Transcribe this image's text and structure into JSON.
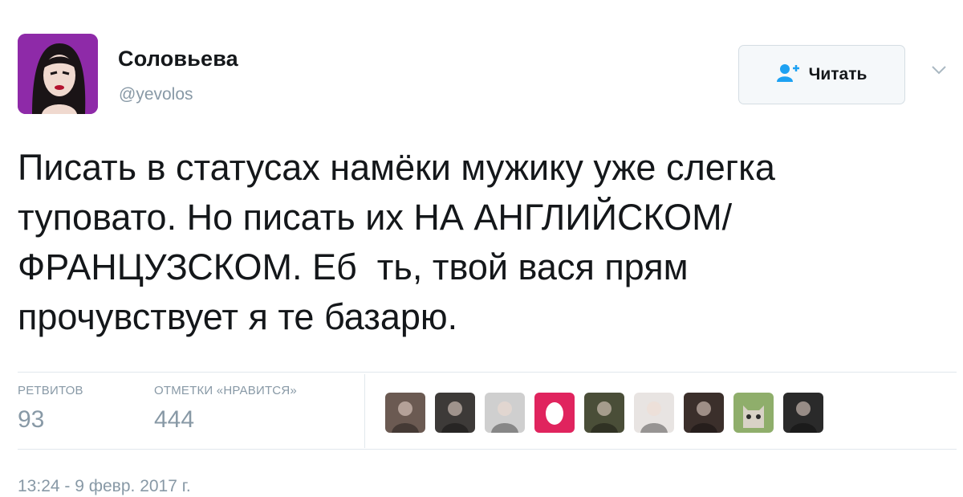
{
  "user": {
    "display_name": "Соловьева",
    "handle": "@yevolos"
  },
  "follow_button": {
    "label": "Читать",
    "icon": "add-user-icon"
  },
  "menu": {
    "icon": "chevron-down-icon"
  },
  "tweet": {
    "lines": [
      "Писать в статусах намёки мужику уже слегка",
      "туповато. Но писать их НА АНГЛИЙСКОМ/",
      "ФРАНЦУЗСКОМ. Еб  ть, твой вася прям",
      "прочувствует я те базарю."
    ]
  },
  "stats": {
    "retweets_label": "РЕТВИТОВ",
    "retweets_count": "93",
    "likes_label": "ОТМЕТКИ «НРАВИТСЯ»",
    "likes_count": "444"
  },
  "likers": [
    {
      "icon": "user-avatar",
      "bg": "#6b5a52"
    },
    {
      "icon": "user-avatar",
      "bg": "#3d3a38"
    },
    {
      "icon": "user-avatar",
      "bg": "#cfcfcf"
    },
    {
      "icon": "egg-avatar",
      "bg": "#e0245e"
    },
    {
      "icon": "user-avatar",
      "bg": "#4a4e38"
    },
    {
      "icon": "user-avatar",
      "bg": "#e8e4e2"
    },
    {
      "icon": "user-avatar",
      "bg": "#3b2f2b"
    },
    {
      "icon": "cat-avatar",
      "bg": "#8fae6b"
    },
    {
      "icon": "user-avatar",
      "bg": "#2a2a2a"
    }
  ],
  "timestamp": "13:24 - 9 февр. 2017 г.",
  "colors": {
    "text": "#14171a",
    "muted": "#8899a6",
    "accent": "#1da1f2",
    "avatar_bg": "#8e2aa8"
  }
}
